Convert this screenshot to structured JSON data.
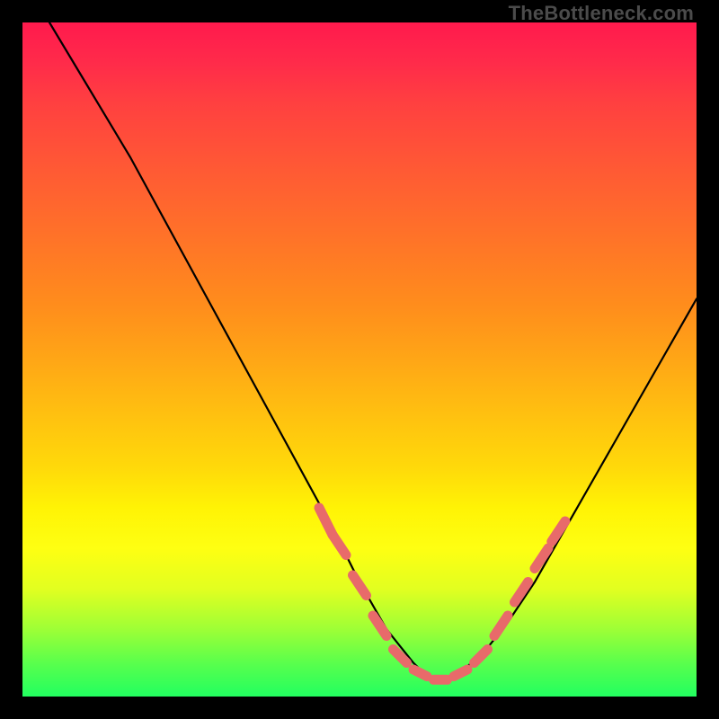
{
  "watermark": "TheBottleneck.com",
  "chart_data": {
    "type": "line",
    "title": "",
    "xlabel": "",
    "ylabel": "",
    "xlim": [
      0,
      100
    ],
    "ylim": [
      0,
      100
    ],
    "grid": false,
    "series": [
      {
        "name": "curve",
        "color": "#000000",
        "x": [
          4,
          10,
          16,
          22,
          28,
          34,
          40,
          46,
          50,
          54,
          58,
          60,
          62,
          64,
          68,
          72,
          76,
          80,
          84,
          88,
          92,
          96,
          100
        ],
        "y": [
          100,
          90,
          80,
          69,
          58,
          47,
          36,
          25,
          17,
          10,
          5,
          3,
          2,
          3,
          6,
          11,
          17,
          24,
          31,
          38,
          45,
          52,
          59
        ]
      },
      {
        "name": "highlight-dashes",
        "color": "#e86a6a",
        "segments": [
          {
            "x": [
              44,
              46
            ],
            "y": [
              28,
              24
            ]
          },
          {
            "x": [
              46,
              48
            ],
            "y": [
              24,
              21
            ]
          },
          {
            "x": [
              49,
              51
            ],
            "y": [
              18,
              15
            ]
          },
          {
            "x": [
              52,
              54
            ],
            "y": [
              12,
              9
            ]
          },
          {
            "x": [
              55,
              57
            ],
            "y": [
              7,
              5
            ]
          },
          {
            "x": [
              58,
              60
            ],
            "y": [
              4,
              3
            ]
          },
          {
            "x": [
              61,
              63
            ],
            "y": [
              2.5,
              2.5
            ]
          },
          {
            "x": [
              64,
              66
            ],
            "y": [
              3,
              4
            ]
          },
          {
            "x": [
              67,
              69
            ],
            "y": [
              5,
              7
            ]
          },
          {
            "x": [
              70,
              72
            ],
            "y": [
              9,
              12
            ]
          },
          {
            "x": [
              73,
              75
            ],
            "y": [
              14,
              17
            ]
          },
          {
            "x": [
              76,
              78
            ],
            "y": [
              19,
              22
            ]
          },
          {
            "x": [
              78.5,
              80.5
            ],
            "y": [
              23,
              26
            ]
          }
        ]
      }
    ]
  }
}
